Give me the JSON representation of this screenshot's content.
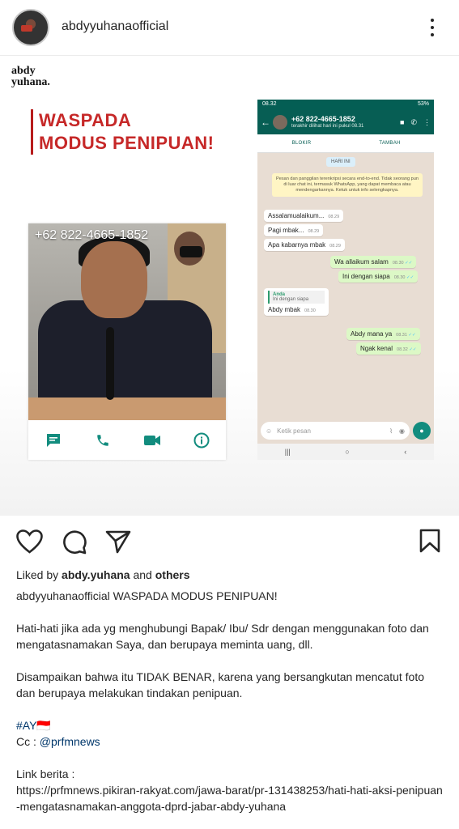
{
  "header": {
    "username": "abdyyuhanaofficial"
  },
  "post": {
    "brand_line1": "abdy",
    "brand_line2": "yuhana.",
    "warning_line1": "WASPADA",
    "warning_line2": "MODUS PENIPUAN!",
    "photo_phone": "+62 822-4665-1852",
    "screenshot": {
      "status_time": "08.32",
      "status_battery": "53%",
      "contact": "+62 822-4665-1852",
      "last_seen": "terakhir dilihat hari ini pukul 08.31",
      "block": "BLOKIR",
      "add": "TAMBAH",
      "date": "HARI INI",
      "encryption": "Pesan dan panggilan terenkripsi secara end-to-end. Tidak seorang pun di luar chat ini, termasuk WhatsApp, yang dapat membaca atau mendengarkannya. Ketuk untuk info selengkapnya.",
      "messages": [
        {
          "text": "Assalamualaikum...",
          "time": "08.29"
        },
        {
          "text": "Pagi mbak...",
          "time": "08.29"
        },
        {
          "text": "Apa kabarnya mbak",
          "time": "08.29"
        },
        {
          "text": "Wa allaikum salam",
          "time": "08.30"
        },
        {
          "text": "Ini dengan siapa",
          "time": "08.30"
        },
        {
          "quote_name": "Anda",
          "quote_text": "Ini dengan siapa",
          "text": "Abdy mbak",
          "time": "08.30"
        },
        {
          "text": "Abdy mana ya",
          "time": "08.31"
        },
        {
          "text": "Ngak kenal",
          "time": "08.32"
        }
      ],
      "input_placeholder": "Ketik pesan"
    }
  },
  "engagement": {
    "liked_prefix": "Liked by ",
    "liked_user": "abdy.yuhana",
    "liked_and": " and ",
    "liked_others": "others"
  },
  "caption": {
    "username": "abdyyuhanaofficial",
    "title": " WASPADA MODUS PENIPUAN!",
    "para1": "Hati-hati jika ada yg menghubungi Bapak/ Ibu/ Sdr dengan menggunakan foto dan mengatasnamakan Saya, dan berupaya meminta uang, dll.",
    "para2": "Disampaikan bahwa itu TIDAK BENAR, karena yang bersangkutan mencatut foto dan berupaya melakukan tindakan penipuan.",
    "hashtag": "#AY🇮🇩",
    "cc_prefix": "Cc : ",
    "cc_mention": "@prfmnews",
    "link_label": "Link berita :",
    "link_url": "https://prfmnews.pikiran-rakyat.com/jawa-barat/pr-131438253/hati-hati-aksi-penipuan-mengatasnamakan-anggota-dprd-jabar-abdy-yuhana"
  }
}
